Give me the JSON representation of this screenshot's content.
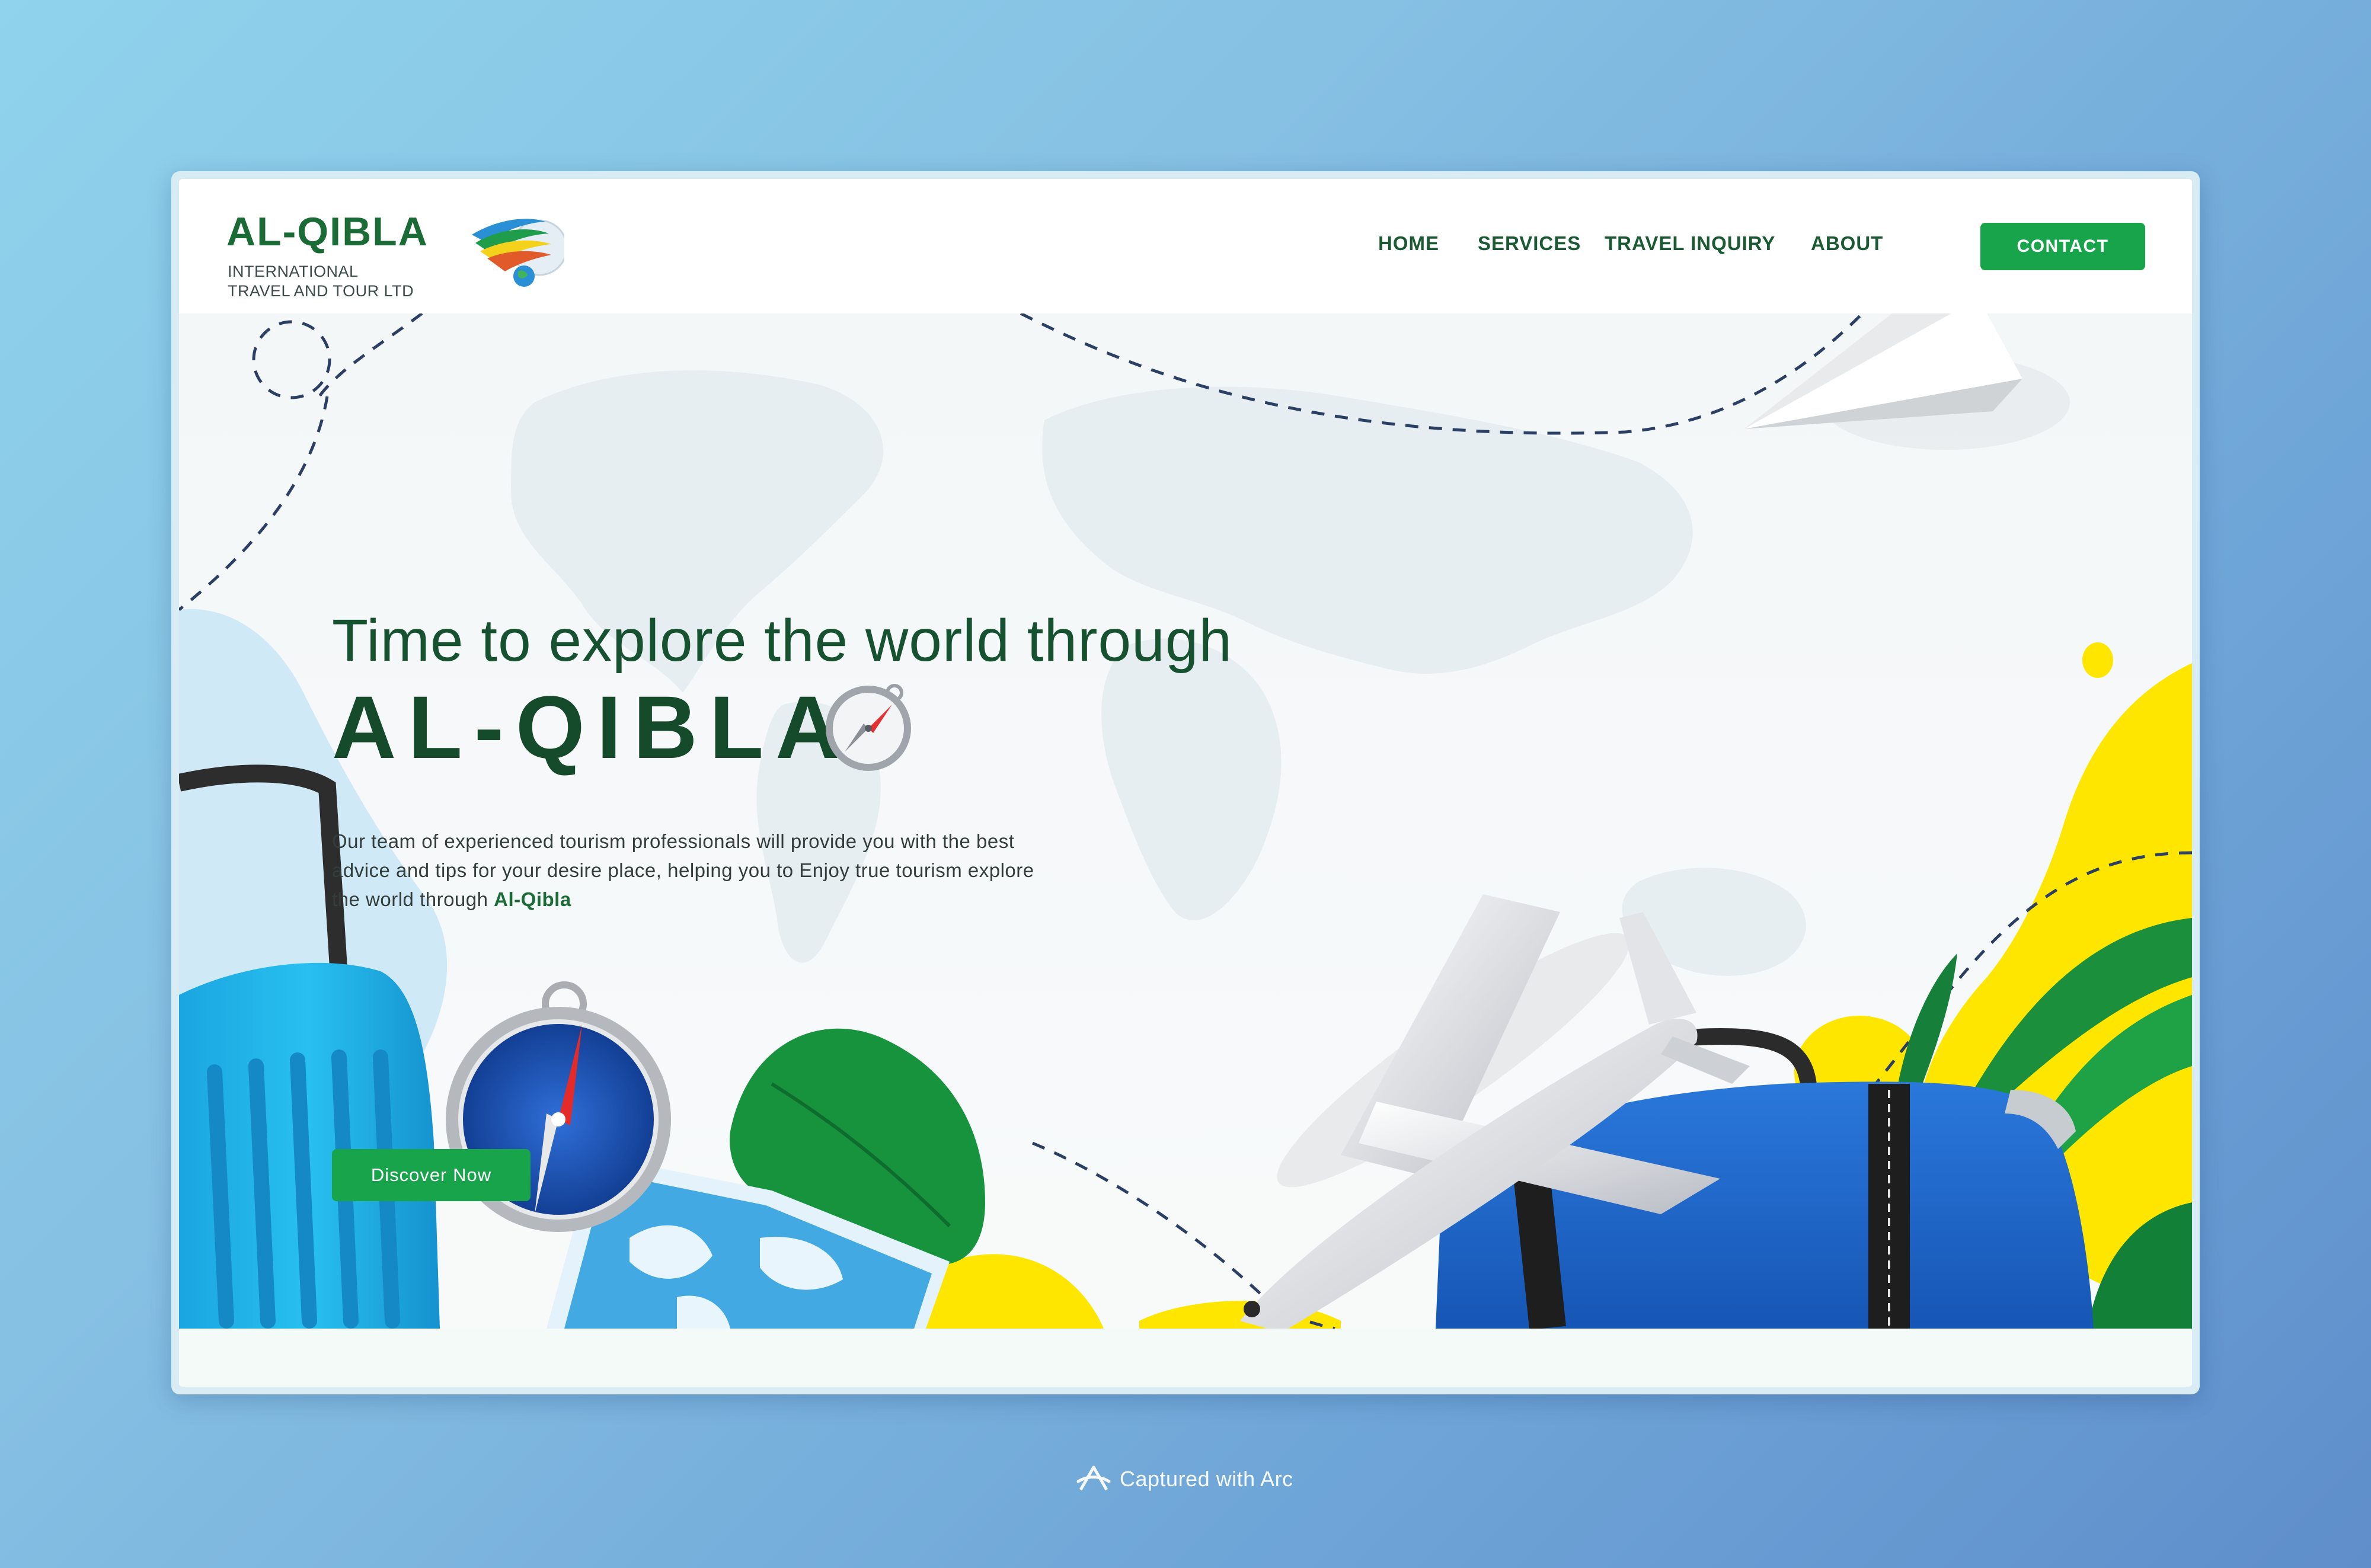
{
  "brand": {
    "name": "AL-QIBLA",
    "subtitle_line1": "INTERNATIONAL",
    "subtitle_line2": "TRAVEL AND TOUR LTD"
  },
  "nav": {
    "items": [
      {
        "label": "HOME"
      },
      {
        "label": "SERVICES"
      },
      {
        "label": "TRAVEL INQUIRY"
      },
      {
        "label": "ABOUT"
      }
    ],
    "contact_label": "CONTACT"
  },
  "hero": {
    "title": "Time to explore the world through",
    "brand": "AL-QIBLA",
    "description_text": "Our team of experienced tourism professionals will provide you with the best advice and tips for your desire place, helping you to Enjoy true tourism explore the world through ",
    "description_highlight": "Al-Qibla",
    "button_label": "Discover Now"
  },
  "capture": {
    "label": "Captured with Arc"
  },
  "colors": {
    "brand_green": "#1a6b35",
    "button_green": "#17a44a",
    "accent_yellow": "#ffe600",
    "suitcase_blue": "#1e6fd1"
  }
}
